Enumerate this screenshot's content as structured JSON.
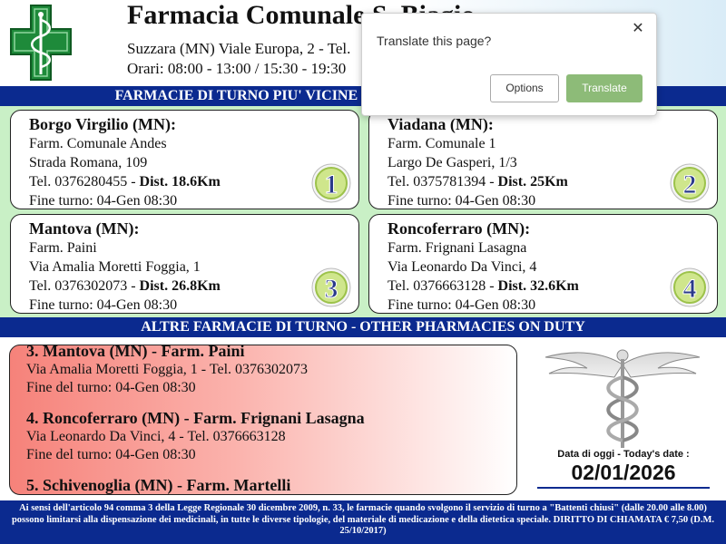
{
  "header": {
    "title": "Farmacia Comunale S. Biagio",
    "address": "Suzzara (MN) Viale Europa, 2 - Tel.",
    "hours": "Orari: 08:00 - 13:00 / 15:30 - 19:30"
  },
  "nearest_bar": "FARMACIE DI TURNO PIU' VICINE - NEAREST PHARMACIES ON DUTY",
  "nearest": [
    {
      "town": "Borgo Virgilio (MN):",
      "name": "Farm. Comunale Andes",
      "street": "Strada Romana, 109",
      "tel": "Tel. 0376280455 - ",
      "dist": "Dist. 18.6Km",
      "end": "Fine turno: 04-Gen 08:30",
      "badge": "1"
    },
    {
      "town": "Viadana (MN):",
      "name": "Farm. Comunale 1",
      "street": "Largo De Gasperi, 1/3",
      "tel": "Tel. 0375781394 - ",
      "dist": "Dist. 25Km",
      "end": "Fine turno: 04-Gen 08:30",
      "badge": "2"
    },
    {
      "town": "Mantova (MN):",
      "name": "Farm. Paini",
      "street": "Via Amalia Moretti Foggia, 1",
      "tel": "Tel. 0376302073 - ",
      "dist": "Dist. 26.8Km",
      "end": "Fine turno: 04-Gen 08:30",
      "badge": "3"
    },
    {
      "town": "Roncoferraro (MN):",
      "name": "Farm. Frignani Lasagna",
      "street": "Via Leonardo Da Vinci, 4",
      "tel": "Tel. 0376663128 - ",
      "dist": "Dist. 32.6Km",
      "end": "Fine turno: 04-Gen 08:30",
      "badge": "4"
    }
  ],
  "others_bar": "ALTRE FARMACIE DI TURNO - OTHER PHARMACIES ON DUTY",
  "others": [
    {
      "title": "3. Mantova (MN) - Farm. Paini",
      "street": "Via Amalia Moretti Foggia, 1 - Tel. 0376302073",
      "end": "Fine del turno: 04-Gen 08:30"
    },
    {
      "title": "4. Roncoferraro (MN) - Farm. Frignani Lasagna",
      "street": "Via Leonardo Da Vinci, 4 - Tel. 0376663128",
      "end": "Fine del turno: 04-Gen 08:30"
    },
    {
      "title": "5. Schivenoglia (MN) - Farm. Martelli",
      "street": "",
      "end": ""
    }
  ],
  "date": {
    "label": "Data di oggi - Today's date :",
    "value": "02/01/2026"
  },
  "footer": "Ai sensi dell'articolo 94 comma 3 della Legge Regionale 30 dicembre 2009, n. 33, le farmacie quando svolgono il servizio di turno a \"Battenti chiusi\" (dalle 20.00 alle 8.00) possono limitarsi alla dispensazione dei medicinali, in tutte le diverse tipologie, del materiale di medicazione e della dietetica speciale. DIRITTO DI CHIAMATA € 7,50 (D.M. 25/10/2017)",
  "popup": {
    "title": "Translate this page?",
    "options_label": "Options",
    "translate_label": "Translate",
    "close_glyph": "✕"
  },
  "colors": {
    "bar_blue": "#0b2a8f",
    "cards_green": "#c9f0c6",
    "logo_green": "#1e8a3a",
    "translate_green": "#8dbb78"
  }
}
